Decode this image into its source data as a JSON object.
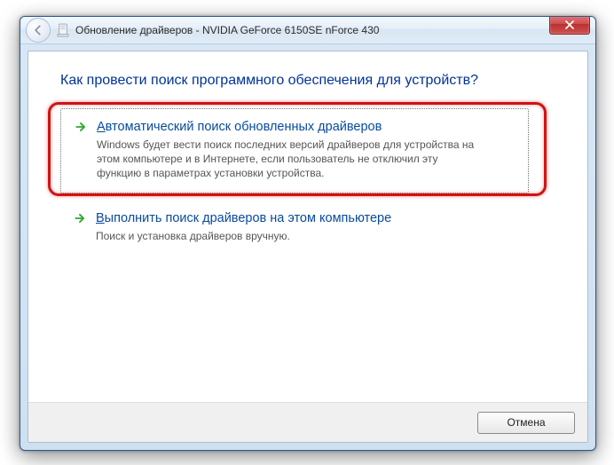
{
  "titlebar": {
    "title": "Обновление драйверов - NVIDIA GeForce 6150SE nForce 430"
  },
  "main": {
    "heading": "Как провести поиск программного обеспечения для устройств?",
    "options": [
      {
        "mnemonic": "А",
        "title_rest": "втоматический поиск обновленных драйверов",
        "desc": "Windows будет вести поиск последних версий драйверов для устройства на этом компьютере и в Интернете, если пользователь не отключил эту функцию в параметрах установки устройства."
      },
      {
        "mnemonic": "В",
        "title_rest": "ыполнить поиск драйверов на этом компьютере",
        "desc": "Поиск и установка драйверов вручную."
      }
    ]
  },
  "footer": {
    "cancel": "Отмена"
  }
}
